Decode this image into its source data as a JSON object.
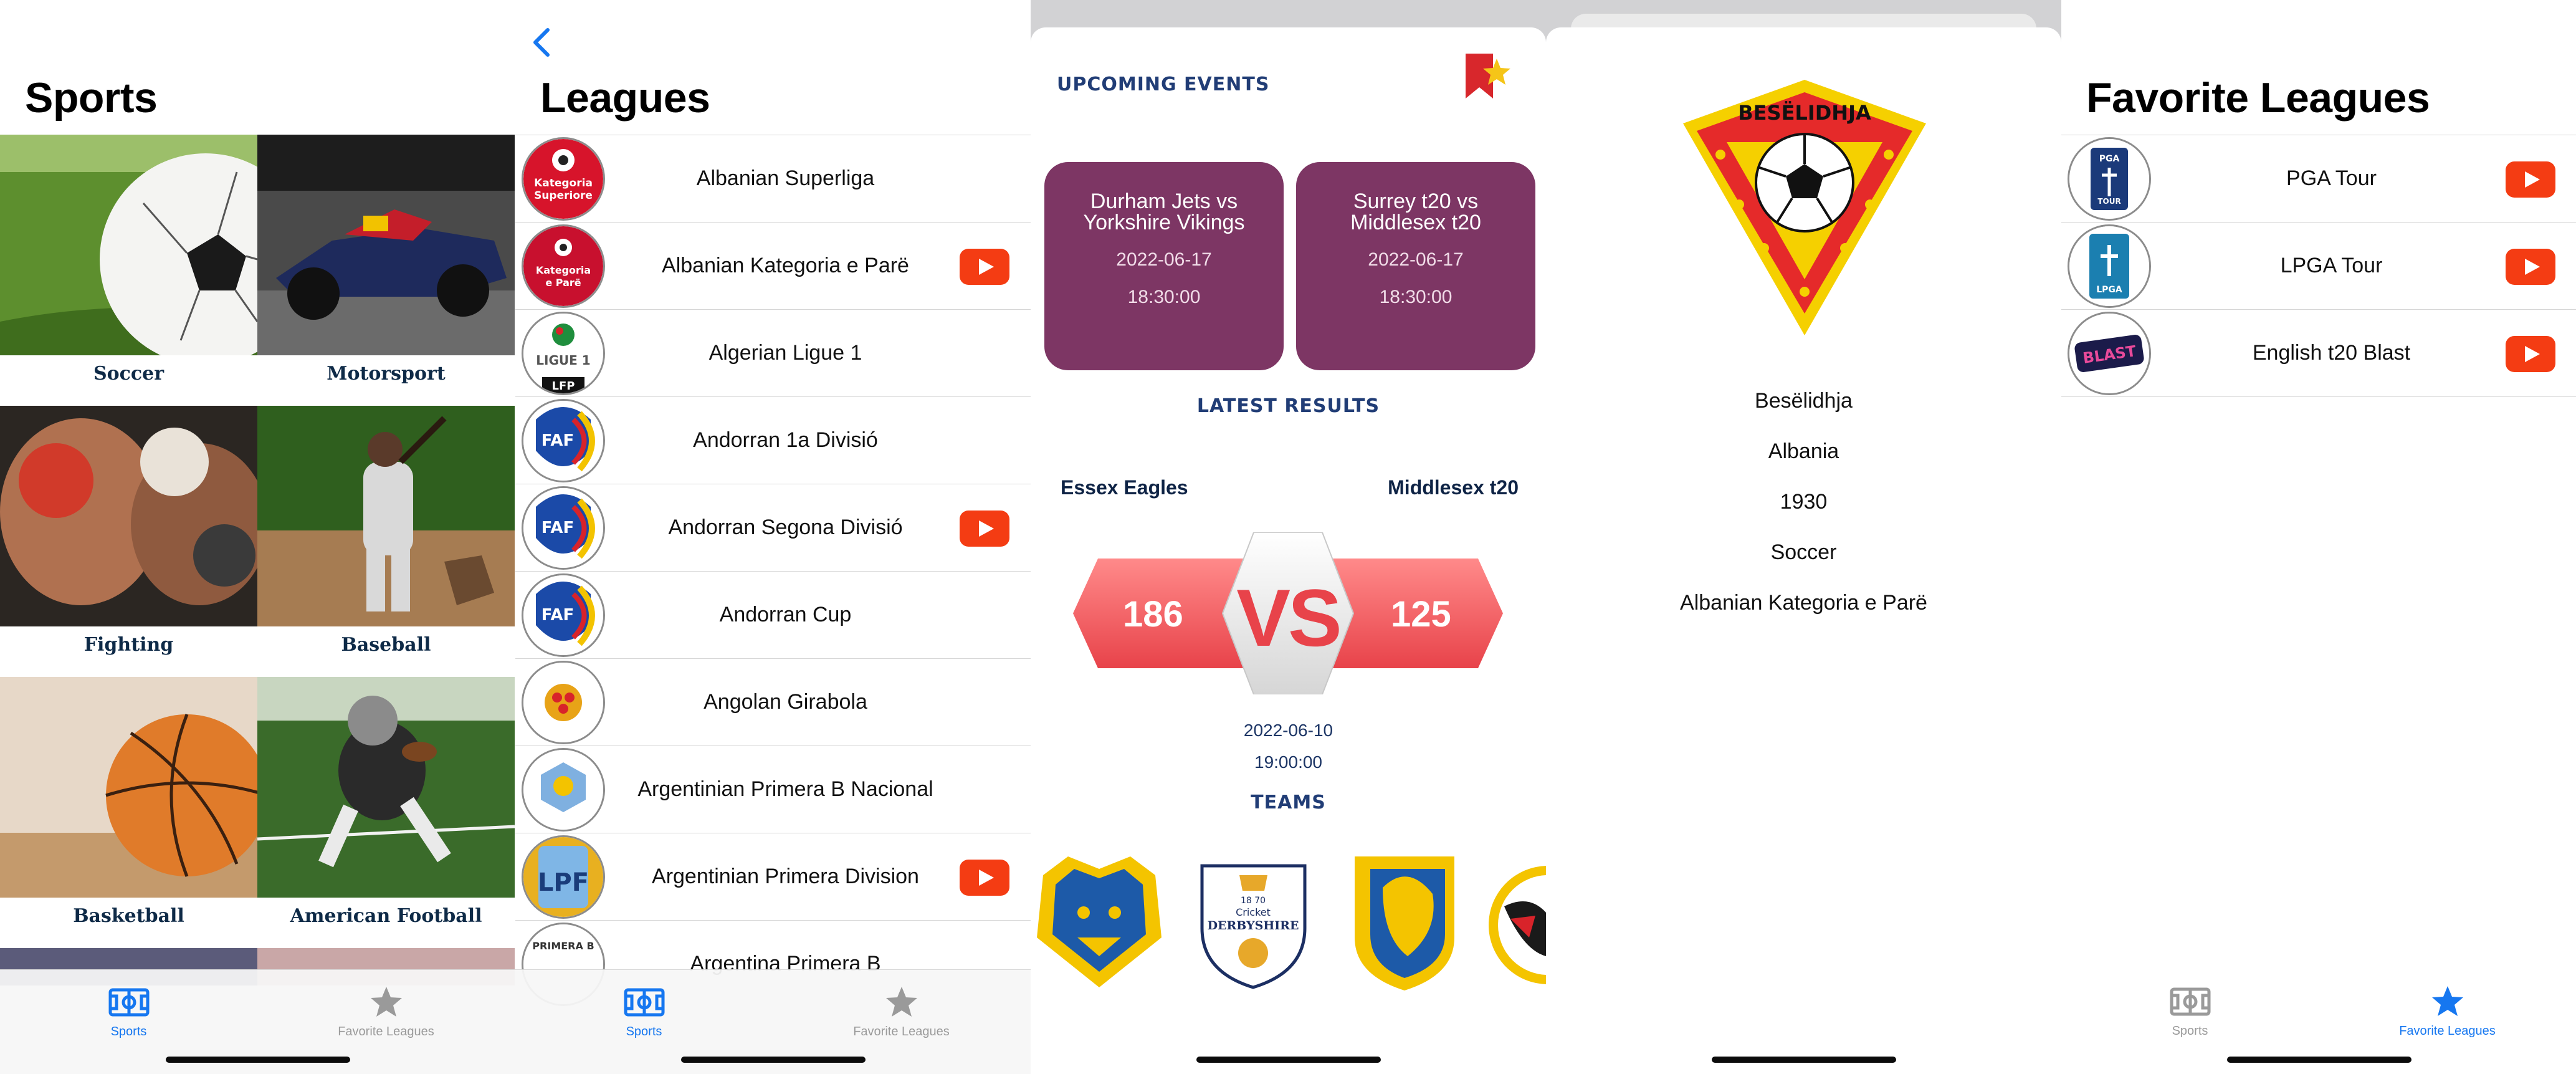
{
  "colors": {
    "accent_blue": "#1677f0",
    "youtube_red": "#f43c13",
    "event_card": "#7d3664",
    "section_navy": "#213d76"
  },
  "sports_screen": {
    "title": "Sports",
    "items": [
      {
        "label": "Soccer"
      },
      {
        "label": "Motorsport"
      },
      {
        "label": "Fighting"
      },
      {
        "label": "Baseball"
      },
      {
        "label": "Basketball"
      },
      {
        "label": "American Football"
      }
    ]
  },
  "tabbar": {
    "sports_label": "Sports",
    "favorites_label": "Favorite Leagues",
    "sports_icon": "stadium-icon",
    "favorites_icon": "star-icon"
  },
  "leagues_screen": {
    "title": "Leagues",
    "leagues": [
      {
        "name": "Albanian Superliga",
        "youtube": false,
        "logo_text": "Kategoria Superiore"
      },
      {
        "name": "Albanian Kategoria e Parë",
        "youtube": true,
        "logo_text": "Kategoria e Parë"
      },
      {
        "name": "Algerian Ligue 1",
        "youtube": false,
        "logo_text": "LIGUE 1"
      },
      {
        "name": "Andorran 1a Divisió",
        "youtube": false,
        "logo_text": "FAF"
      },
      {
        "name": "Andorran Segona Divisió",
        "youtube": true,
        "logo_text": "FAF"
      },
      {
        "name": "Andorran Cup",
        "youtube": false,
        "logo_text": "FAF"
      },
      {
        "name": "Angolan Girabola",
        "youtube": false,
        "logo_text": ""
      },
      {
        "name": "Argentinian Primera B Nacional",
        "youtube": false,
        "logo_text": ""
      },
      {
        "name": "Argentinian Primera Division",
        "youtube": true,
        "logo_text": "LPF"
      },
      {
        "name": "Argentina Primera B",
        "youtube": false,
        "logo_text": "PRIMERA B"
      }
    ]
  },
  "details_screen": {
    "upcoming_title": "UPCOMING EVENTS",
    "events": [
      {
        "teams": "Durham Jets vs Yorkshire Vikings",
        "date": "2022-06-17",
        "time": "18:30:00"
      },
      {
        "teams": "Surrey t20 vs Middlesex t20",
        "date": "2022-06-17",
        "time": "18:30:00"
      }
    ],
    "latest_title": "LATEST RESULTS",
    "result": {
      "home": "Essex Eagles",
      "away": "Middlesex t20",
      "home_score": "186",
      "away_score": "125",
      "vs": "VS",
      "date": "2022-06-10",
      "time": "19:00:00"
    },
    "teams_title": "TEAMS",
    "team_badges": [
      {
        "name": "bear-crest-badge"
      },
      {
        "name": "derbyshire-badge",
        "text": "DERBYSHIRE",
        "sub": "Cricket",
        "years": "18 70"
      },
      {
        "name": "lion-crest-badge"
      },
      {
        "name": "eagle-crest-badge"
      }
    ]
  },
  "team_screen": {
    "badge_text": "BESËLIDHJA",
    "name": "Besëlidhja",
    "country": "Albania",
    "founded": "1930",
    "sport": "Soccer",
    "league": "Albanian Kategoria e Parë"
  },
  "favorites_screen": {
    "title": "Favorite Leagues",
    "leagues": [
      {
        "name": "PGA Tour",
        "logo_text": "PGA TOUR"
      },
      {
        "name": "LPGA Tour",
        "logo_text": "LPGA"
      },
      {
        "name": "English t20 Blast",
        "logo_text": "BLAST"
      }
    ]
  }
}
